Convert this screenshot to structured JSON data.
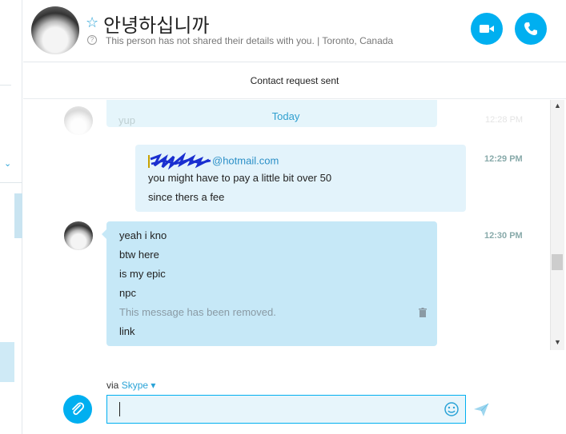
{
  "header": {
    "contact_name": "안녕하십니까",
    "info_text": "This person has not shared their details with you.  |  Toronto, Canada",
    "info_icon": "?",
    "star_icon": "☆",
    "video_call_icon": "video-camera-icon",
    "call_icon": "phone-icon"
  },
  "request_bar": {
    "text": "Contact request sent"
  },
  "chat": {
    "date_divider": "Today",
    "previous_message_text": "yup",
    "previous_message_time": "12:28 PM",
    "outgoing": {
      "email_suffix": "@hotmail.com",
      "lines": [
        "you might have to pay a little bit over 50",
        "since thers a fee"
      ],
      "time": "12:29 PM"
    },
    "incoming": {
      "lines": [
        "yeah i kno",
        "btw here",
        "is my epic",
        "npc"
      ],
      "removed_text": "This message has been removed.",
      "last_line": "link",
      "time": "12:30 PM"
    }
  },
  "compose": {
    "via_label": "via",
    "via_service": "Skype",
    "via_chevron": "▾",
    "input_value": "",
    "input_placeholder": ""
  },
  "sidebar": {
    "chevron": "⌄"
  },
  "colors": {
    "accent": "#00aff0",
    "bubble_incoming": "#c6e8f7",
    "bubble_outgoing": "#e3f3fb",
    "link": "#2a8fc7"
  }
}
